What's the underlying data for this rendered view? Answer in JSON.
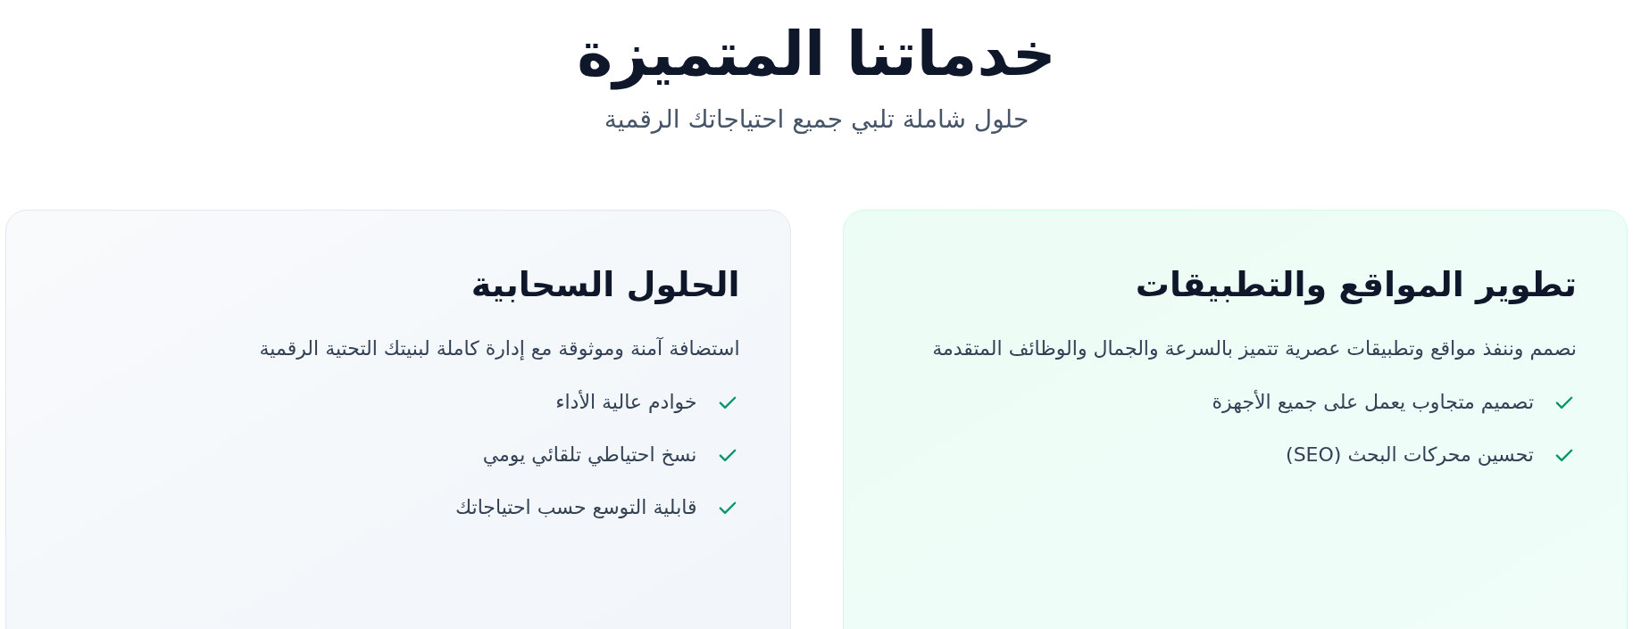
{
  "header": {
    "title": "خدماتنا المتميزة",
    "subtitle": "حلول شاملة تلبي جميع احتياجاتك الرقمية"
  },
  "services": [
    {
      "kind": "web",
      "title": "تطوير المواقع والتطبيقات",
      "description": "نصمم وننفذ مواقع وتطبيقات عصرية تتميز بالسرعة والجمال والوظائف المتقدمة",
      "features": [
        "تصميم متجاوب يعمل على جميع الأجهزة",
        "تحسين محركات البحث (SEO)"
      ]
    },
    {
      "kind": "cloud",
      "title": "الحلول السحابية",
      "description": "استضافة آمنة وموثوقة مع إدارة كاملة لبنيتك التحتية الرقمية",
      "features": [
        "خوادم عالية الأداء",
        "نسخ احتياطي تلقائي يومي",
        "قابلية التوسع حسب احتياجاتك"
      ]
    }
  ]
}
